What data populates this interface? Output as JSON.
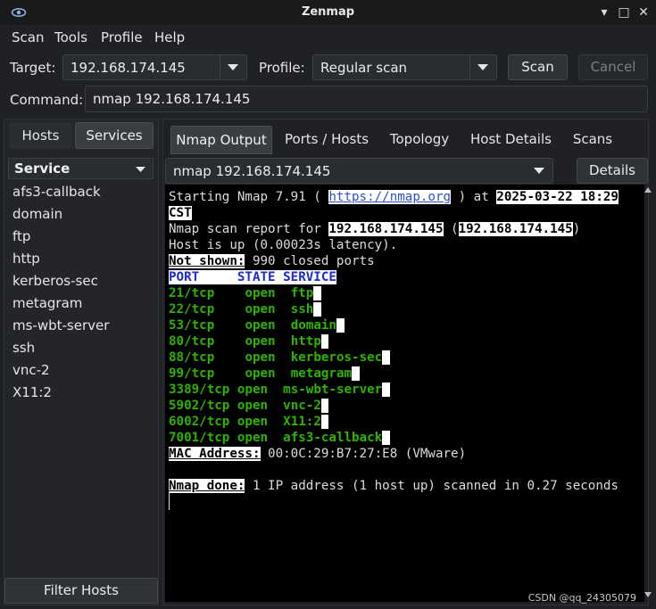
{
  "window": {
    "title": "Zenmap",
    "controls": [
      "▾",
      "□",
      "✕"
    ]
  },
  "menu": [
    "Scan",
    "Tools",
    "Profile",
    "Help"
  ],
  "toolbar": {
    "target_label": "Target:",
    "target_value": "192.168.174.145",
    "profile_label": "Profile:",
    "profile_value": "Regular scan",
    "scan_button": "Scan",
    "cancel_button": "Cancel",
    "command_label": "Command:",
    "command_value": "nmap 192.168.174.145"
  },
  "left": {
    "hosts_tab": "Hosts",
    "services_tab": "Services",
    "header": "Service",
    "services": [
      "afs3-callback",
      "domain",
      "ftp",
      "http",
      "kerberos-sec",
      "metagram",
      "ms-wbt-server",
      "ssh",
      "vnc-2",
      "X11:2"
    ],
    "filter_button": "Filter Hosts"
  },
  "right": {
    "tabs": [
      "Nmap Output",
      "Ports / Hosts",
      "Topology",
      "Host Details",
      "Scans"
    ],
    "selected_command": "nmap 192.168.174.145",
    "details_button": "Details"
  },
  "output": {
    "line1_pre": "Starting Nmap 7.91 ( ",
    "line1_link": "https://nmap.org",
    "line1_mid": " ) at ",
    "line1_date": "2025-03-22 18:29",
    "line2_tz": "CST",
    "line3_pre": "Nmap scan report for ",
    "line3_ip": "192.168.174.145",
    "line3_open": " (",
    "line3_ip2": "192.168.174.145",
    "line3_close": ")",
    "line4": "Host is up (0.00023s latency).",
    "line5_label": "Not shown:",
    "line5_rest": " 990 closed ports",
    "port_header": "PORT     STATE SERVICE",
    "ports": [
      {
        "port": "21/tcp  ",
        "state": "open",
        "service": "ftp"
      },
      {
        "port": "22/tcp  ",
        "state": "open",
        "service": "ssh"
      },
      {
        "port": "53/tcp  ",
        "state": "open",
        "service": "domain"
      },
      {
        "port": "80/tcp  ",
        "state": "open",
        "service": "http"
      },
      {
        "port": "88/tcp  ",
        "state": "open",
        "service": "kerberos-sec"
      },
      {
        "port": "99/tcp  ",
        "state": "open",
        "service": "metagram"
      },
      {
        "port": "3389/tcp",
        "state": "open",
        "service": "ms-wbt-server"
      },
      {
        "port": "5902/tcp",
        "state": "open",
        "service": "vnc-2"
      },
      {
        "port": "6002/tcp",
        "state": "open",
        "service": "X11:2"
      },
      {
        "port": "7001/tcp",
        "state": "open",
        "service": "afs3-callback"
      }
    ],
    "mac_label": "MAC Address:",
    "mac_rest": " 00:0C:29:B7:27:E8 (VMware)",
    "done_label": "Nmap done:",
    "done_rest": " 1 IP address (1 host up) scanned in 0.27 seconds"
  },
  "watermark": "CSDN @qq_24305079",
  "icons": {
    "app": "eye-icon",
    "dropdown": "chevron-down-icon"
  }
}
